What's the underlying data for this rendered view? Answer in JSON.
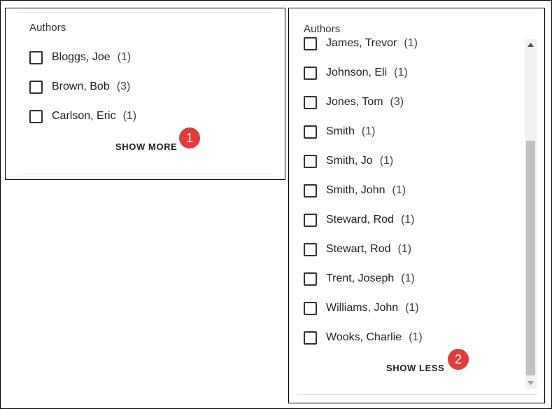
{
  "left_panel": {
    "heading": "Authors",
    "items": [
      {
        "label": "Bloggs, Joe",
        "count": "(1)"
      },
      {
        "label": "Brown, Bob",
        "count": "(3)"
      },
      {
        "label": "Carlson, Eric",
        "count": "(1)"
      }
    ],
    "toggle_label": "SHOW MORE",
    "callout": "1"
  },
  "right_panel": {
    "heading": "Authors",
    "items": [
      {
        "label": "James, Trevor",
        "count": "(1)"
      },
      {
        "label": "Johnson, Eli",
        "count": "(1)"
      },
      {
        "label": "Jones, Tom",
        "count": "(3)"
      },
      {
        "label": "Smith",
        "count": "(1)"
      },
      {
        "label": "Smith, Jo",
        "count": "(1)"
      },
      {
        "label": "Smith, John",
        "count": "(1)"
      },
      {
        "label": "Steward, Rod",
        "count": "(1)"
      },
      {
        "label": "Stewart, Rod",
        "count": "(1)"
      },
      {
        "label": "Trent, Joseph",
        "count": "(1)"
      },
      {
        "label": "Williams, John",
        "count": "(1)"
      },
      {
        "label": "Wooks, Charlie",
        "count": "(1)"
      }
    ],
    "toggle_label": "SHOW LESS",
    "callout": "2"
  },
  "colors": {
    "callout": "#e23b3b",
    "scroll_thumb": "#c1c1c1",
    "scroll_track": "#f1f1f1"
  }
}
